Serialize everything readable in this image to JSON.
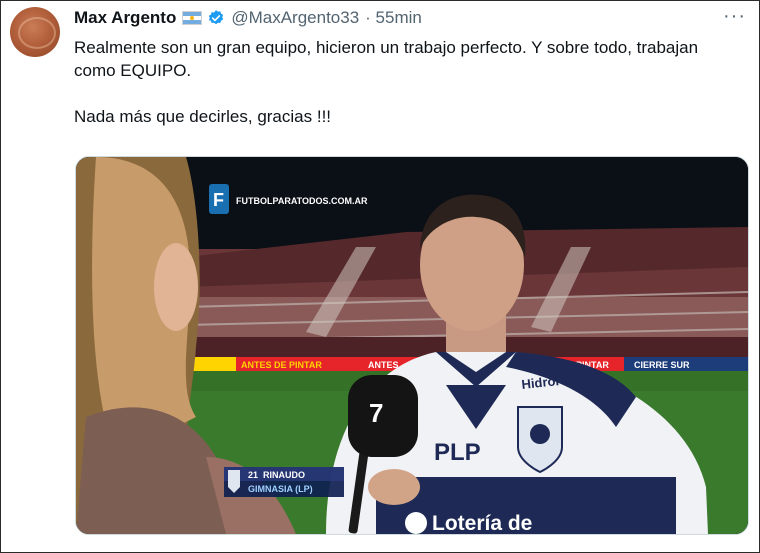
{
  "tweet": {
    "author_name": "Max Argento",
    "author_handle": "@MaxArgento33",
    "time": "· 55min",
    "more_label": "···",
    "text_line1": "Realmente son un gran equipo, hicieron un trabajo perfecto. Y sobre todo, trabajan como EQUIPO.",
    "text_line2": "Nada más que decirles, gracias !!!"
  },
  "media": {
    "broadcaster": "FUTBOLPARATODOS.COM.AR",
    "ads": [
      "ANTES DE PINTAR",
      "ANTES",
      "PINTAR",
      "CIERRE SUR"
    ],
    "sponsor_chest": "PLP",
    "sponsor_shoulder": "HidroPlat",
    "sponsor_bottom": "Lotería de",
    "caption_number": "21",
    "caption_name": "RINAUDO",
    "caption_team": "GIMNASIA (LP)",
    "mic_logo": "7"
  },
  "colors": {
    "verified": "#1d9bf0",
    "handle": "#536471",
    "jersey_navy": "#1e2a55",
    "pitch": "#3a7a2c"
  }
}
